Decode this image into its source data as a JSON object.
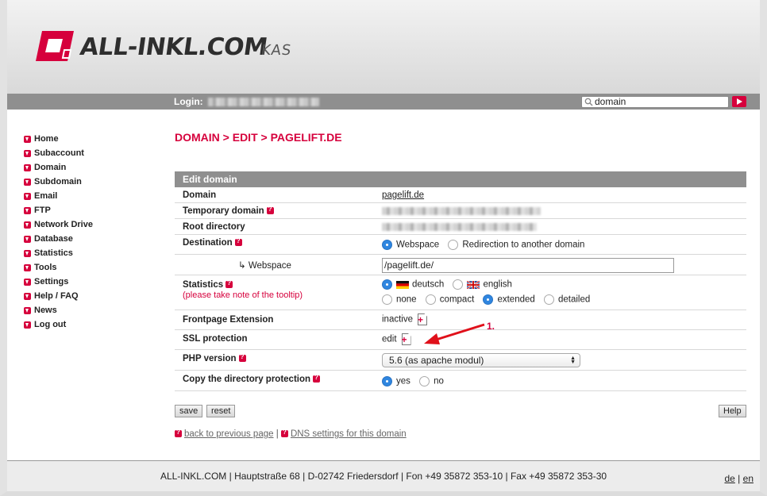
{
  "brand": {
    "name": "ALL-INKL.COM",
    "sub": "KAS",
    "accent": "#d6003c"
  },
  "topbar": {
    "login_label": "Login:",
    "search_value": "domain"
  },
  "nav": [
    {
      "label": "Home"
    },
    {
      "label": "Subaccount"
    },
    {
      "label": "Domain"
    },
    {
      "label": "Subdomain"
    },
    {
      "label": "Email"
    },
    {
      "label": "FTP"
    },
    {
      "label": "Network Drive"
    },
    {
      "label": "Database"
    },
    {
      "label": "Statistics"
    },
    {
      "label": "Tools"
    },
    {
      "label": "Settings"
    },
    {
      "label": "Help / FAQ"
    },
    {
      "label": "News"
    },
    {
      "label": "Log out"
    }
  ],
  "page": {
    "title": "DOMAIN > EDIT > PAGELIFT.DE"
  },
  "panel": {
    "title": "Edit domain",
    "domain": {
      "label": "Domain",
      "value": "pagelift.de"
    },
    "temp_domain": {
      "label": "Temporary domain"
    },
    "root_dir": {
      "label": "Root directory"
    },
    "destination": {
      "label": "Destination",
      "opt1": "Webspace",
      "opt2": "Redirection to another domain",
      "selected": "Webspace"
    },
    "webspace": {
      "label": "↳ Webspace",
      "value": "/pagelift.de/"
    },
    "statistics": {
      "label": "Statistics",
      "note": "(please take note of the tooltip)",
      "lang1": "deutsch",
      "lang2": "english",
      "mode1": "none",
      "mode2": "compact",
      "mode3": "extended",
      "mode4": "detailed",
      "selected_lang": "deutsch",
      "selected_mode": "extended"
    },
    "frontpage": {
      "label": "Frontpage Extension",
      "value": "inactive"
    },
    "ssl": {
      "label": "SSL protection",
      "value": "edit"
    },
    "php": {
      "label": "PHP version",
      "value": "5.6 (as apache modul)"
    },
    "copy_protection": {
      "label": "Copy the directory protection",
      "yes": "yes",
      "no": "no",
      "selected": "yes"
    }
  },
  "buttons": {
    "save": "save",
    "reset": "reset",
    "help": "Help"
  },
  "links": {
    "back": "back to previous page",
    "sep": "|",
    "dns": "DNS settings for this domain"
  },
  "annotation": {
    "marker": "1."
  },
  "footer": {
    "address": "ALL-INKL.COM | Hauptstraße 68 | D-02742 Friedersdorf | Fon +49 35872 353-10 | Fax +49 35872 353-30",
    "lang_de": "de",
    "lang_sep": "|",
    "lang_en": "en"
  }
}
